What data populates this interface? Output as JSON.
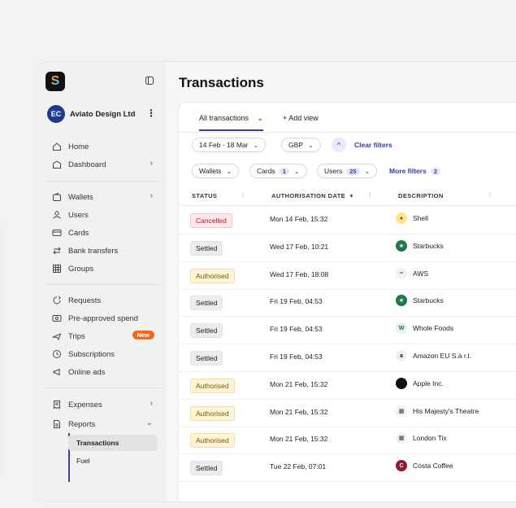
{
  "app": {
    "logo_letter": "S",
    "org": {
      "initials": "EC",
      "name": "Aviato Design Ltd"
    }
  },
  "sidebar": {
    "items": [
      {
        "label": "Home",
        "icon": "home-icon"
      },
      {
        "label": "Dashboard",
        "icon": "dashboard-icon"
      },
      {
        "label": "Wallets",
        "icon": "wallet-icon"
      },
      {
        "label": "Users",
        "icon": "users-icon"
      },
      {
        "label": "Cards",
        "icon": "card-icon"
      },
      {
        "label": "Bank transfers",
        "icon": "transfer-icon"
      },
      {
        "label": "Groups",
        "icon": "groups-icon"
      },
      {
        "label": "Requests",
        "icon": "requests-icon"
      },
      {
        "label": "Pre-approved spend",
        "icon": "preapproved-icon"
      },
      {
        "label": "Trips",
        "icon": "plane-icon",
        "badge": "New"
      },
      {
        "label": "Subscriptions",
        "icon": "subscriptions-icon"
      },
      {
        "label": "Online ads",
        "icon": "megaphone-icon"
      },
      {
        "label": "Expenses",
        "icon": "receipt-icon"
      },
      {
        "label": "Reports",
        "icon": "report-icon"
      }
    ],
    "subitems": [
      {
        "label": "Transactions"
      },
      {
        "label": "Fuel"
      }
    ]
  },
  "main": {
    "title": "Transactions",
    "tabs": {
      "active": "All transactions",
      "add": "+ Add view"
    },
    "filters": {
      "date": "14 Feb - 18 Mar",
      "currency": "GBP",
      "clear": "Clear filters",
      "wallets": "Wallets",
      "cards": "Cards",
      "cards_count": "1",
      "users": "Users",
      "users_count": "25",
      "more": "More filters",
      "more_count": "2"
    },
    "columns": {
      "status": "STATUS",
      "date": "AUTHORISATION DATE",
      "description": "DESCRIPTION"
    },
    "rows": [
      {
        "status": "Cancelled",
        "date": "Mon 14 Feb, 15:32",
        "merchant": "Shell"
      },
      {
        "status": "Settled",
        "date": "Wed 17 Feb, 10:21",
        "merchant": "Starbucks"
      },
      {
        "status": "Authorised",
        "date": "Wed 17 Feb, 18:08",
        "merchant": "AWS"
      },
      {
        "status": "Settled",
        "date": "Fri 19 Feb, 04:53",
        "merchant": "Starbucks"
      },
      {
        "status": "Settled",
        "date": "Fri 19 Feb, 04:53",
        "merchant": "Whole Foods"
      },
      {
        "status": "Settled",
        "date": "Fri 19 Feb, 04:53",
        "merchant": "Amazon EU S.à r.l."
      },
      {
        "status": "Authorised",
        "date": "Mon 21 Feb, 15:32",
        "merchant": "Apple Inc."
      },
      {
        "status": "Authorised",
        "date": "Mon 21 Feb, 15:32",
        "merchant": "His Majesty's Theatre"
      },
      {
        "status": "Authorised",
        "date": "Mon 21 Feb, 15:32",
        "merchant": "London Tix"
      },
      {
        "status": "Settled",
        "date": "Tue 22 Feb, 07:01",
        "merchant": "Costa Coffee"
      }
    ]
  },
  "colors": {
    "accent": "#3a3aa8",
    "new_badge": "#f26b1d",
    "cancelled": "#b3192b",
    "authorised_bg": "#fff4d6"
  }
}
